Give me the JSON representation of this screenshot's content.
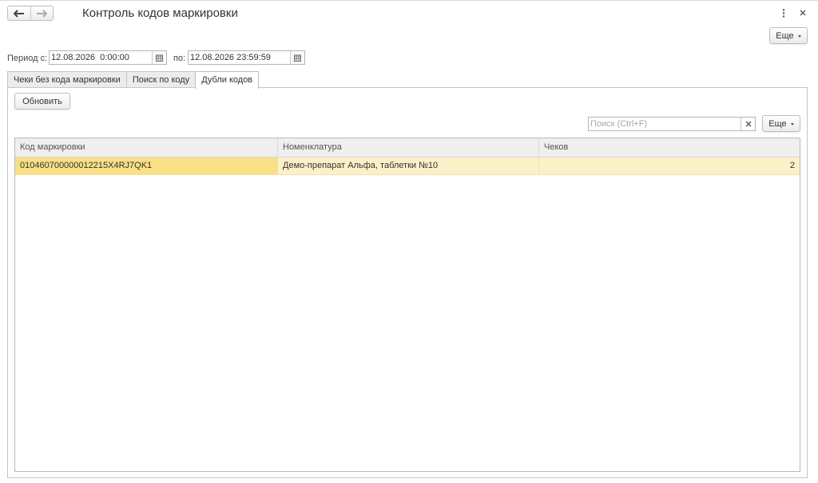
{
  "window": {
    "title": "Контроль кодов маркировки"
  },
  "toolbar": {
    "more_label": "Еще"
  },
  "period": {
    "from_label": "Период с:",
    "from_value": "12.08.2026  0:00:00",
    "to_label": "по:",
    "to_value": "12.08.2026 23:59:59"
  },
  "tabs": [
    {
      "label": "Чеки без кода маркировки",
      "active": false
    },
    {
      "label": "Поиск по коду",
      "active": false
    },
    {
      "label": "Дубли кодов",
      "active": true
    }
  ],
  "panel": {
    "refresh_label": "Обновить",
    "search": {
      "placeholder": "Поиск (Ctrl+F)",
      "value": ""
    },
    "more_label": "Еще"
  },
  "table": {
    "columns": [
      "Код маркировки",
      "Номенклатура",
      "Чеков"
    ],
    "rows": [
      {
        "code": "010460700000012215X4RJ7QK1",
        "item": "Демо-препарат Альфа, таблетки №10",
        "count": "2"
      }
    ]
  }
}
